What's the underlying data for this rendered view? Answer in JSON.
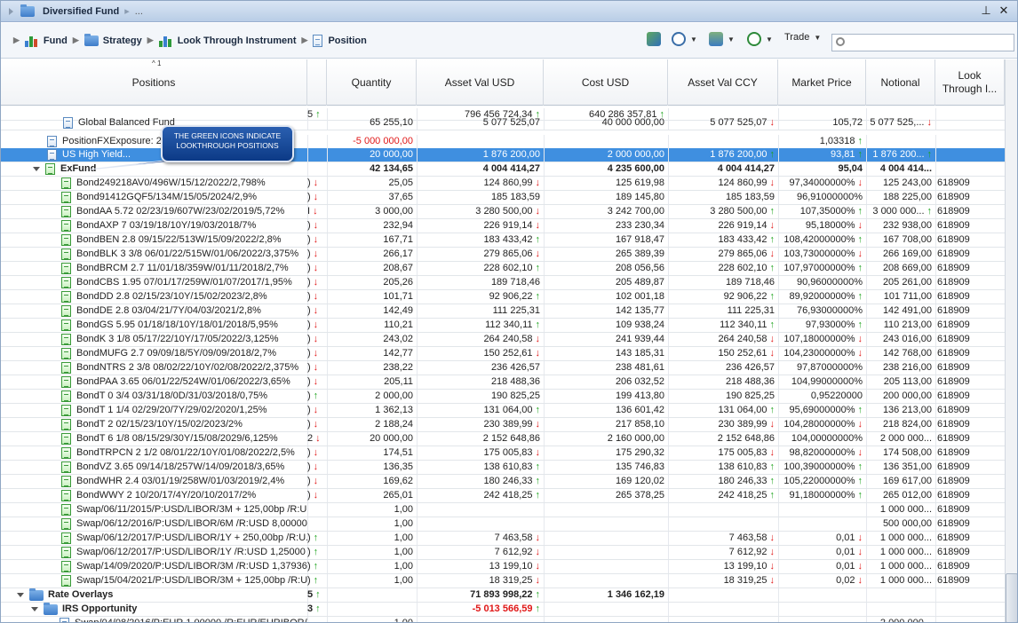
{
  "window": {
    "title": "Diversified Fund",
    "title_ellipsis": "...",
    "pin_glyph": "⊥",
    "close_glyph": "✕"
  },
  "breadcrumb": [
    "Fund",
    "Strategy",
    "Look Through Instrument",
    "Position"
  ],
  "toolbar": {
    "trade_label": "Trade",
    "search_value": ""
  },
  "columns": {
    "positions": "Positions",
    "quantity": "Quantity",
    "asset_val_usd": "Asset Val USD",
    "cost_usd": "Cost USD",
    "asset_val_ccy": "Asset Val CCY",
    "market_price": "Market Price",
    "notional": "Notional",
    "look_through_1": "Look",
    "look_through_2": "Through I...",
    "sort_indicator": "^ 1"
  },
  "callout": {
    "line1": "THE GREEN ICONS INDICATE",
    "line2": "LOOKTHROUGH POSITIONS"
  },
  "rows": [
    {
      "indent": 0,
      "icon": "none",
      "name": "",
      "prefix": "5",
      "pa": "up",
      "qty": "",
      "qa": "",
      "avu": "796 456 724,34",
      "avua": "up",
      "cost": "640 286 357,81",
      "costa": "up",
      "avc": "",
      "avca": "",
      "mp": "",
      "mpa": "",
      "notional": "",
      "na": "",
      "lt": "",
      "style": "total"
    },
    {
      "indent": 70,
      "icon": "blue",
      "name": "Global Balanced Fund",
      "prefix": "",
      "pa": "",
      "qty": "65 255,10",
      "qa": "",
      "avu": "5 077 525,07",
      "avua": "",
      "cost": "40 000 000,00",
      "costa": "",
      "avc": "5 077 525,07",
      "avca": "dn",
      "mp": "105,72",
      "mpa": "",
      "notional": "5 077 525,...",
      "na": "dn",
      "lt": "",
      "style": "clip"
    },
    {
      "indent": 52,
      "icon": "blue",
      "name": "PositionFXExposure: 2...",
      "prefix": "",
      "pa": "",
      "qty": "-5 000 000,00",
      "qa": "",
      "avu": "",
      "avua": "",
      "cost": "",
      "costa": "",
      "avc": "",
      "avca": "",
      "mp": "1,03318",
      "mpa": "up",
      "notional": "",
      "na": "",
      "lt": "",
      "style": "negqty"
    },
    {
      "indent": 52,
      "icon": "blue",
      "name": "US High Yield...",
      "prefix": "",
      "pa": "",
      "qty": "20 000,00",
      "qa": "",
      "avu": "1 876 200,00",
      "avua": "",
      "cost": "2 000 000,00",
      "costa": "",
      "avc": "1 876 200,00",
      "avca": "up",
      "mp": "93,81",
      "mpa": "up",
      "notional": "1 876 200...",
      "na": "up",
      "lt": "",
      "style": "sel"
    },
    {
      "indent": 36,
      "icon": "green",
      "name": "ExFund",
      "prefix": "",
      "pa": "",
      "qty": "42 134,65",
      "qa": "",
      "avu": "4 004 414,27",
      "avua": "",
      "cost": "4 235 600,00",
      "costa": "",
      "avc": "4 004 414,27",
      "avca": "",
      "mp": "95,04",
      "mpa": "",
      "notional": "4 004 414...",
      "na": "",
      "lt": "",
      "style": "bold",
      "expander": true
    },
    {
      "indent": 68,
      "icon": "green",
      "name": "Bond249218AV0/496W/15/12/2022/2,798%",
      "prefix": ")",
      "pa": "dn",
      "qty": "25,05",
      "qa": "",
      "avu": "124 860,99",
      "avua": "dn",
      "cost": "125 619,98",
      "costa": "",
      "avc": "124 860,99",
      "avca": "dn",
      "mp": "97,34000000%",
      "mpa": "dn",
      "notional": "125 243,00",
      "na": "",
      "lt": "618909"
    },
    {
      "indent": 68,
      "icon": "green",
      "name": "Bond91412GQF5/134M/15/05/2024/2,9%",
      "prefix": ")",
      "pa": "dn",
      "qty": "37,65",
      "qa": "",
      "avu": "185 183,59",
      "avua": "",
      "cost": "189 145,80",
      "costa": "",
      "avc": "185 183,59",
      "avca": "",
      "mp": "96,91000000%",
      "mpa": "",
      "notional": "188 225,00",
      "na": "",
      "lt": "618909"
    },
    {
      "indent": 68,
      "icon": "green",
      "name": "BondAA 5.72 02/23/19/607W/23/02/2019/5,72%",
      "prefix": "I",
      "pa": "dn",
      "qty": "3 000,00",
      "qa": "",
      "avu": "3 280 500,00",
      "avua": "dn",
      "cost": "3 242 700,00",
      "costa": "",
      "avc": "3 280 500,00",
      "avca": "up",
      "mp": "107,35000%",
      "mpa": "up",
      "notional": "3 000 000...",
      "na": "up",
      "lt": "618909"
    },
    {
      "indent": 68,
      "icon": "green",
      "name": "BondAXP 7 03/19/18/10Y/19/03/2018/7%",
      "prefix": ")",
      "pa": "dn",
      "qty": "232,94",
      "qa": "",
      "avu": "226 919,14",
      "avua": "dn",
      "cost": "233 230,34",
      "costa": "",
      "avc": "226 919,14",
      "avca": "dn",
      "mp": "95,18000%",
      "mpa": "dn",
      "notional": "232 938,00",
      "na": "",
      "lt": "618909"
    },
    {
      "indent": 68,
      "icon": "green",
      "name": "BondBEN 2.8 09/15/22/513W/15/09/2022/2,8%",
      "prefix": ")",
      "pa": "dn",
      "qty": "167,71",
      "qa": "",
      "avu": "183 433,42",
      "avua": "up",
      "cost": "167 918,47",
      "costa": "",
      "avc": "183 433,42",
      "avca": "up",
      "mp": "108,42000000%",
      "mpa": "up",
      "notional": "167 708,00",
      "na": "",
      "lt": "618909"
    },
    {
      "indent": 68,
      "icon": "green",
      "name": "BondBLK 3 3/8 06/01/22/515W/01/06/2022/3,375%",
      "prefix": ")",
      "pa": "dn",
      "qty": "266,17",
      "qa": "",
      "avu": "279 865,06",
      "avua": "dn",
      "cost": "265 389,39",
      "costa": "",
      "avc": "279 865,06",
      "avca": "dn",
      "mp": "103,73000000%",
      "mpa": "dn",
      "notional": "266 169,00",
      "na": "",
      "lt": "618909"
    },
    {
      "indent": 68,
      "icon": "green",
      "name": "BondBRCM 2.7 11/01/18/359W/01/11/2018/2,7%",
      "prefix": ")",
      "pa": "dn",
      "qty": "208,67",
      "qa": "",
      "avu": "228 602,10",
      "avua": "up",
      "cost": "208 056,56",
      "costa": "",
      "avc": "228 602,10",
      "avca": "up",
      "mp": "107,97000000%",
      "mpa": "up",
      "notional": "208 669,00",
      "na": "",
      "lt": "618909"
    },
    {
      "indent": 68,
      "icon": "green",
      "name": "BondCBS 1.95 07/01/17/259W/01/07/2017/1,95%",
      "prefix": ")",
      "pa": "dn",
      "qty": "205,26",
      "qa": "",
      "avu": "189 718,46",
      "avua": "",
      "cost": "205 489,87",
      "costa": "",
      "avc": "189 718,46",
      "avca": "",
      "mp": "90,96000000%",
      "mpa": "",
      "notional": "205 261,00",
      "na": "",
      "lt": "618909"
    },
    {
      "indent": 68,
      "icon": "green",
      "name": "BondDD 2.8 02/15/23/10Y/15/02/2023/2,8%",
      "prefix": ")",
      "pa": "dn",
      "qty": "101,71",
      "qa": "",
      "avu": "92 906,22",
      "avua": "up",
      "cost": "102 001,18",
      "costa": "",
      "avc": "92 906,22",
      "avca": "up",
      "mp": "89,92000000%",
      "mpa": "up",
      "notional": "101 711,00",
      "na": "",
      "lt": "618909"
    },
    {
      "indent": 68,
      "icon": "green",
      "name": "BondDE 2.8 03/04/21/7Y/04/03/2021/2,8%",
      "prefix": ")",
      "pa": "dn",
      "qty": "142,49",
      "qa": "",
      "avu": "111 225,31",
      "avua": "",
      "cost": "142 135,77",
      "costa": "",
      "avc": "111 225,31",
      "avca": "",
      "mp": "76,93000000%",
      "mpa": "",
      "notional": "142 491,00",
      "na": "",
      "lt": "618909"
    },
    {
      "indent": 68,
      "icon": "green",
      "name": "BondGS 5.95 01/18/18/10Y/18/01/2018/5,95%",
      "prefix": ")",
      "pa": "dn",
      "qty": "110,21",
      "qa": "",
      "avu": "112 340,11",
      "avua": "up",
      "cost": "109 938,24",
      "costa": "",
      "avc": "112 340,11",
      "avca": "up",
      "mp": "97,93000%",
      "mpa": "up",
      "notional": "110 213,00",
      "na": "",
      "lt": "618909"
    },
    {
      "indent": 68,
      "icon": "green",
      "name": "BondK 3 1/8 05/17/22/10Y/17/05/2022/3,125%",
      "prefix": ")",
      "pa": "dn",
      "qty": "243,02",
      "qa": "",
      "avu": "264 240,58",
      "avua": "dn",
      "cost": "241 939,44",
      "costa": "",
      "avc": "264 240,58",
      "avca": "dn",
      "mp": "107,18000000%",
      "mpa": "dn",
      "notional": "243 016,00",
      "na": "",
      "lt": "618909"
    },
    {
      "indent": 68,
      "icon": "green",
      "name": "BondMUFG 2.7 09/09/18/5Y/09/09/2018/2,7%",
      "prefix": ")",
      "pa": "dn",
      "qty": "142,77",
      "qa": "",
      "avu": "150 252,61",
      "avua": "dn",
      "cost": "143 185,31",
      "costa": "",
      "avc": "150 252,61",
      "avca": "dn",
      "mp": "104,23000000%",
      "mpa": "dn",
      "notional": "142 768,00",
      "na": "",
      "lt": "618909"
    },
    {
      "indent": 68,
      "icon": "green",
      "name": "BondNTRS 2 3/8 08/02/22/10Y/02/08/2022/2,375%",
      "prefix": ")",
      "pa": "dn",
      "qty": "238,22",
      "qa": "",
      "avu": "236 426,57",
      "avua": "",
      "cost": "238 481,61",
      "costa": "",
      "avc": "236 426,57",
      "avca": "",
      "mp": "97,87000000%",
      "mpa": "",
      "notional": "238 216,00",
      "na": "",
      "lt": "618909"
    },
    {
      "indent": 68,
      "icon": "green",
      "name": "BondPAA 3.65 06/01/22/524W/01/06/2022/3,65%",
      "prefix": ")",
      "pa": "dn",
      "qty": "205,11",
      "qa": "",
      "avu": "218 488,36",
      "avua": "",
      "cost": "206 032,52",
      "costa": "",
      "avc": "218 488,36",
      "avca": "",
      "mp": "104,99000000%",
      "mpa": "",
      "notional": "205 113,00",
      "na": "",
      "lt": "618909"
    },
    {
      "indent": 68,
      "icon": "green",
      "name": "BondT 0 3/4 03/31/18/0D/31/03/2018/0,75%",
      "prefix": ")",
      "pa": "up",
      "qty": "2 000,00",
      "qa": "",
      "avu": "190 825,25",
      "avua": "",
      "cost": "199 413,80",
      "costa": "",
      "avc": "190 825,25",
      "avca": "",
      "mp": "0,95220000",
      "mpa": "",
      "notional": "200 000,00",
      "na": "",
      "lt": "618909"
    },
    {
      "indent": 68,
      "icon": "green",
      "name": "BondT 1 1/4 02/29/20/7Y/29/02/2020/1,25%",
      "prefix": ")",
      "pa": "dn",
      "qty": "1 362,13",
      "qa": "",
      "avu": "131 064,00",
      "avua": "up",
      "cost": "136 601,42",
      "costa": "",
      "avc": "131 064,00",
      "avca": "up",
      "mp": "95,69000000%",
      "mpa": "up",
      "notional": "136 213,00",
      "na": "",
      "lt": "618909"
    },
    {
      "indent": 68,
      "icon": "green",
      "name": "BondT 2 02/15/23/10Y/15/02/2023/2%",
      "prefix": ")",
      "pa": "dn",
      "qty": "2 188,24",
      "qa": "",
      "avu": "230 389,99",
      "avua": "dn",
      "cost": "217 858,10",
      "costa": "",
      "avc": "230 389,99",
      "avca": "dn",
      "mp": "104,28000000%",
      "mpa": "dn",
      "notional": "218 824,00",
      "na": "",
      "lt": "618909"
    },
    {
      "indent": 68,
      "icon": "green",
      "name": "BondT 6 1/8 08/15/29/30Y/15/08/2029/6,125%",
      "prefix": "2",
      "pa": "dn",
      "qty": "20 000,00",
      "qa": "",
      "avu": "2 152 648,86",
      "avua": "",
      "cost": "2 160 000,00",
      "costa": "",
      "avc": "2 152 648,86",
      "avca": "",
      "mp": "104,00000000%",
      "mpa": "",
      "notional": "2 000 000...",
      "na": "",
      "lt": "618909"
    },
    {
      "indent": 68,
      "icon": "green",
      "name": "BondTRPCN 2 1/2 08/01/22/10Y/01/08/2022/2,5%",
      "prefix": ")",
      "pa": "dn",
      "qty": "174,51",
      "qa": "",
      "avu": "175 005,83",
      "avua": "dn",
      "cost": "175 290,32",
      "costa": "",
      "avc": "175 005,83",
      "avca": "dn",
      "mp": "98,82000000%",
      "mpa": "dn",
      "notional": "174 508,00",
      "na": "",
      "lt": "618909"
    },
    {
      "indent": 68,
      "icon": "green",
      "name": "BondVZ 3.65 09/14/18/257W/14/09/2018/3,65%",
      "prefix": ")",
      "pa": "dn",
      "qty": "136,35",
      "qa": "",
      "avu": "138 610,83",
      "avua": "up",
      "cost": "135 746,83",
      "costa": "",
      "avc": "138 610,83",
      "avca": "up",
      "mp": "100,39000000%",
      "mpa": "up",
      "notional": "136 351,00",
      "na": "",
      "lt": "618909"
    },
    {
      "indent": 68,
      "icon": "green",
      "name": "BondWHR 2.4 03/01/19/258W/01/03/2019/2,4%",
      "prefix": ")",
      "pa": "dn",
      "qty": "169,62",
      "qa": "",
      "avu": "180 246,33",
      "avua": "up",
      "cost": "169 120,02",
      "costa": "",
      "avc": "180 246,33",
      "avca": "up",
      "mp": "105,22000000%",
      "mpa": "up",
      "notional": "169 617,00",
      "na": "",
      "lt": "618909"
    },
    {
      "indent": 68,
      "icon": "green",
      "name": "BondWWY 2 10/20/17/4Y/20/10/2017/2%",
      "prefix": ")",
      "pa": "dn",
      "qty": "265,01",
      "qa": "",
      "avu": "242 418,25",
      "avua": "up",
      "cost": "265 378,25",
      "costa": "",
      "avc": "242 418,25",
      "avca": "up",
      "mp": "91,18000000%",
      "mpa": "up",
      "notional": "265 012,00",
      "na": "",
      "lt": "618909"
    },
    {
      "indent": 68,
      "icon": "green",
      "name": "Swap/06/11/2015/P:USD/LIBOR/3M + 125,00bp /R:U...",
      "prefix": "",
      "pa": "",
      "qty": "1,00",
      "qa": "",
      "avu": "",
      "avua": "",
      "cost": "",
      "costa": "",
      "avc": "",
      "avca": "",
      "mp": "",
      "mpa": "",
      "notional": "1 000 000...",
      "na": "",
      "lt": "618909"
    },
    {
      "indent": 68,
      "icon": "green",
      "name": "Swap/06/12/2016/P:USD/LIBOR/6M /R:USD 8,00000",
      "prefix": "",
      "pa": "",
      "qty": "1,00",
      "qa": "",
      "avu": "",
      "avua": "",
      "cost": "",
      "costa": "",
      "avc": "",
      "avca": "",
      "mp": "",
      "mpa": "",
      "notional": "500 000,00",
      "na": "",
      "lt": "618909"
    },
    {
      "indent": 68,
      "icon": "green",
      "name": "Swap/06/12/2017/P:USD/LIBOR/1Y + 250,00bp /R:U...",
      "prefix": ")",
      "pa": "up",
      "qty": "1,00",
      "qa": "",
      "avu": "7 463,58",
      "avua": "dn",
      "cost": "",
      "costa": "",
      "avc": "7 463,58",
      "avca": "dn",
      "mp": "0,01",
      "mpa": "dn",
      "notional": "1 000 000...",
      "na": "",
      "lt": "618909"
    },
    {
      "indent": 68,
      "icon": "green",
      "name": "Swap/06/12/2017/P:USD/LIBOR/1Y /R:USD 1,25000",
      "prefix": ")",
      "pa": "up",
      "qty": "1,00",
      "qa": "",
      "avu": "7 612,92",
      "avua": "dn",
      "cost": "",
      "costa": "",
      "avc": "7 612,92",
      "avca": "dn",
      "mp": "0,01",
      "mpa": "dn",
      "notional": "1 000 000...",
      "na": "",
      "lt": "618909"
    },
    {
      "indent": 68,
      "icon": "green",
      "name": "Swap/14/09/2020/P:USD/LIBOR/3M /R:USD 1,37936",
      "prefix": ")",
      "pa": "up",
      "qty": "1,00",
      "qa": "",
      "avu": "13 199,10",
      "avua": "dn",
      "cost": "",
      "costa": "",
      "avc": "13 199,10",
      "avca": "dn",
      "mp": "0,01",
      "mpa": "dn",
      "notional": "1 000 000...",
      "na": "",
      "lt": "618909"
    },
    {
      "indent": 68,
      "icon": "green",
      "name": "Swap/15/04/2021/P:USD/LIBOR/3M + 125,00bp /R:U...",
      "prefix": ")",
      "pa": "up",
      "qty": "1,00",
      "qa": "",
      "avu": "18 319,25",
      "avua": "dn",
      "cost": "",
      "costa": "",
      "avc": "18 319,25",
      "avca": "dn",
      "mp": "0,02",
      "mpa": "dn",
      "notional": "1 000 000...",
      "na": "",
      "lt": "618909"
    },
    {
      "indent": 18,
      "icon": "folder",
      "name": "Rate Overlays",
      "prefix": "5",
      "pa": "up",
      "qty": "",
      "qa": "",
      "avu": "71 893 998,22",
      "avua": "up",
      "cost": "1 346 162,19",
      "costa": "",
      "avc": "",
      "avca": "",
      "mp": "",
      "mpa": "",
      "notional": "",
      "na": "",
      "lt": "",
      "style": "bold",
      "expander": true
    },
    {
      "indent": 34,
      "icon": "folder",
      "name": "IRS Opportunity",
      "prefix": "3",
      "pa": "up",
      "qty": "",
      "qa": "",
      "avu": "-5 013 566,59",
      "avua": "up",
      "cost": "",
      "costa": "",
      "avc": "",
      "avca": "",
      "mp": "",
      "mpa": "",
      "notional": "",
      "na": "",
      "lt": "",
      "style": "boldneg",
      "expander": true
    },
    {
      "indent": 66,
      "icon": "blue",
      "name": "Swap/04/08/2016/P:EUR 1,00000 /R:EUR/EURIBOR/...",
      "prefix": "",
      "pa": "",
      "qty": "1,00",
      "qa": "",
      "avu": "",
      "avua": "",
      "cost": "",
      "costa": "",
      "avc": "",
      "avca": "",
      "mp": "",
      "mpa": "",
      "notional": "2 000 000...",
      "na": "",
      "lt": ""
    }
  ]
}
